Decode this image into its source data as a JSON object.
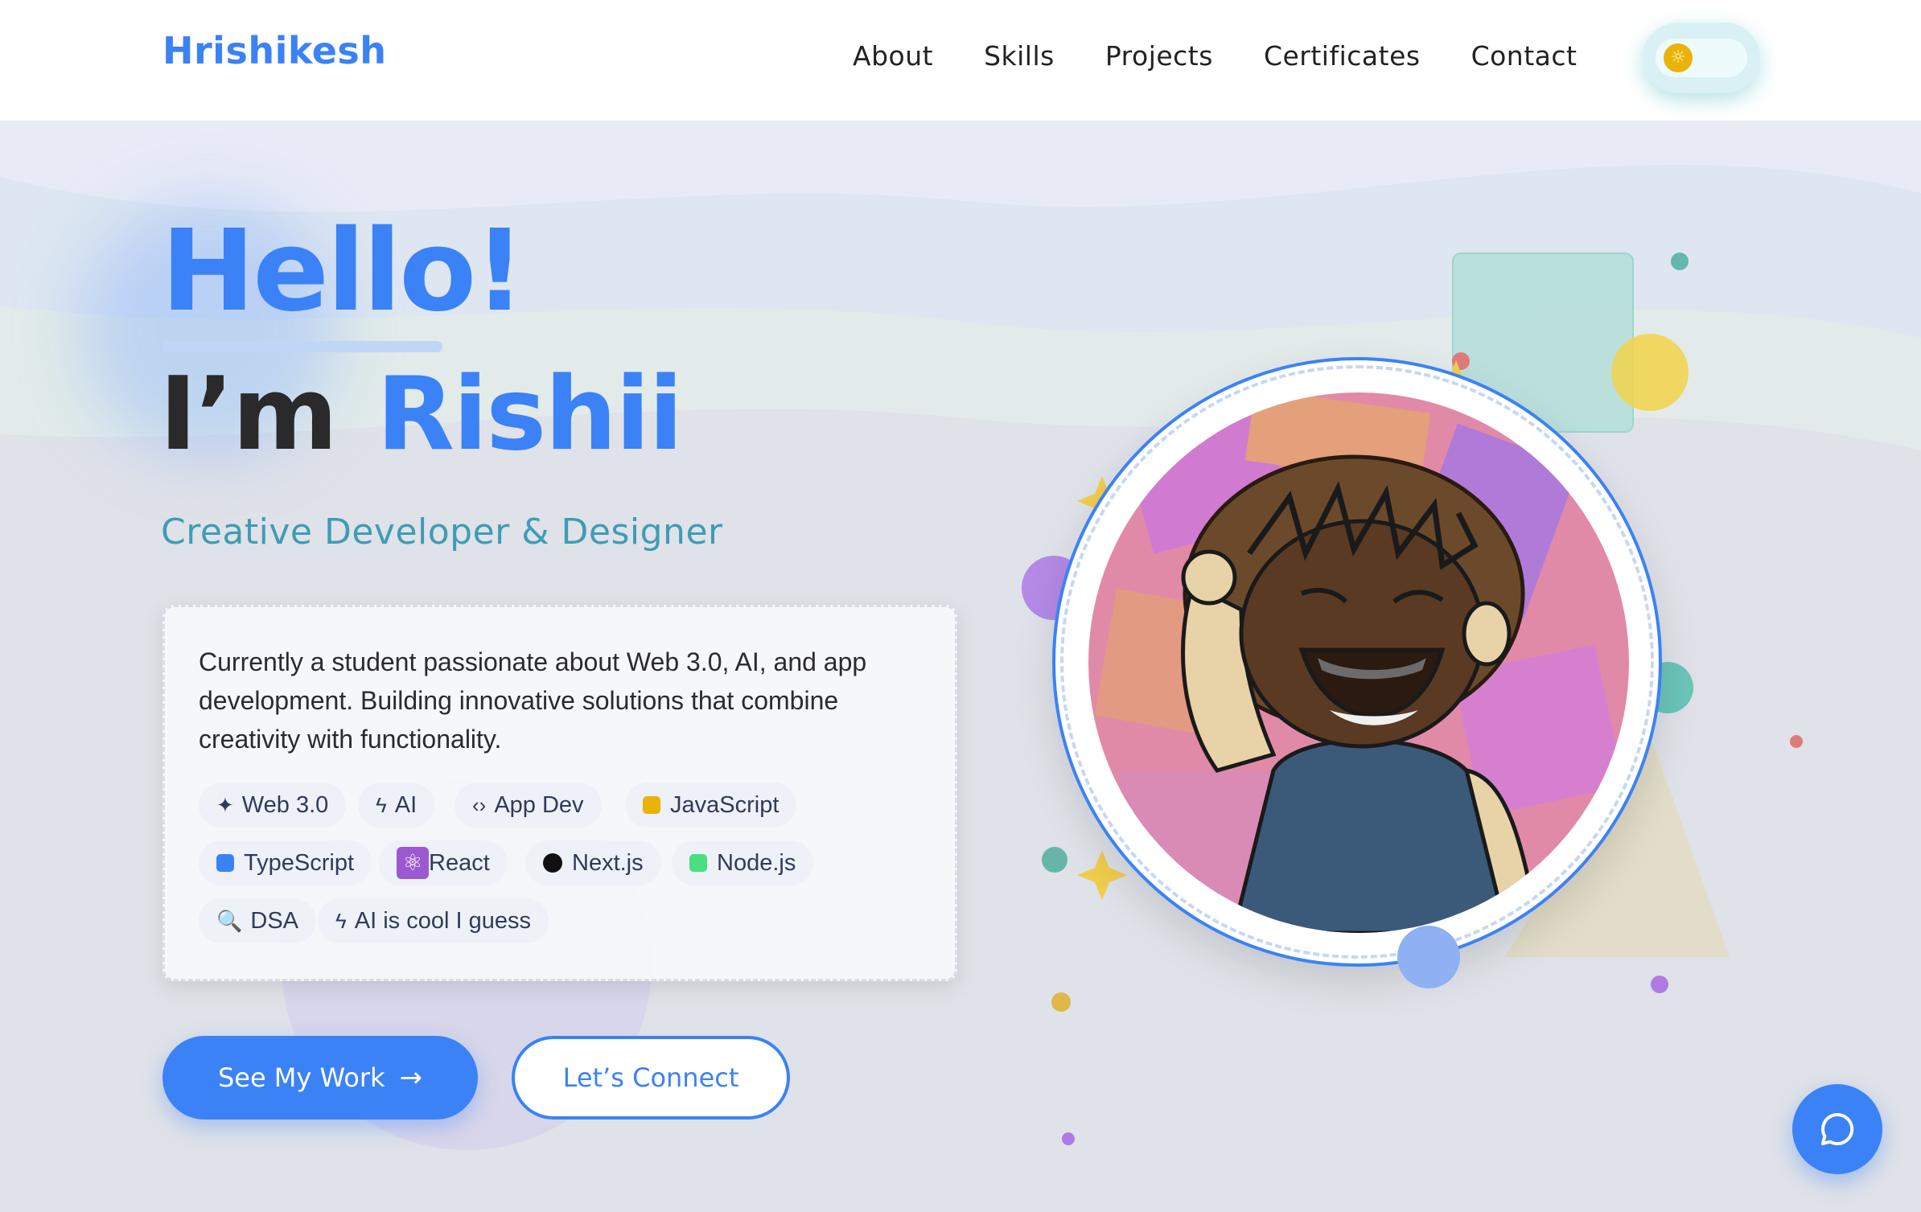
{
  "brand": "Hrishikesh",
  "nav": [
    {
      "label": "About"
    },
    {
      "label": "Skills"
    },
    {
      "label": "Projects"
    },
    {
      "label": "Certificates"
    },
    {
      "label": "Contact"
    }
  ],
  "theme_toggle": {
    "icon": "sun-icon"
  },
  "hero": {
    "hello": "Hello!",
    "im": "I’m",
    "name": "Rishii",
    "tagline": "Creative Developer & Designer"
  },
  "about": {
    "text": "Currently a student passionate about Web 3.0, AI, and app development. Building innovative solutions that combine creativity with functionality.",
    "chips": [
      {
        "label": "Web 3.0",
        "icon": "sparkles-icon"
      },
      {
        "label": "AI",
        "icon": "lightning-icon"
      },
      {
        "label": "App Dev",
        "icon": "code-icon"
      },
      {
        "label": "JavaScript",
        "icon": "javascript-icon",
        "color": "#eab308"
      },
      {
        "label": "TypeScript",
        "icon": "typescript-icon",
        "color": "#3b82f6"
      },
      {
        "label": "React",
        "icon": "atom-icon",
        "color": "#9b59d0"
      },
      {
        "label": "Next.js",
        "icon": "nextjs-icon",
        "color": "#111111"
      },
      {
        "label": "Node.js",
        "icon": "nodejs-icon",
        "color": "#4ade80"
      },
      {
        "label": "DSA",
        "icon": "magnifier-icon"
      },
      {
        "label": "AI is cool I guess",
        "icon": "lightning-icon"
      }
    ]
  },
  "buttons": {
    "primary": "See My Work",
    "secondary": "Let’s Connect"
  },
  "colors": {
    "accent": "#3b82f6",
    "teal": "#3f9cb4",
    "yellow": "#eab308",
    "purple": "#a77be8"
  },
  "chat": {
    "icon": "chat-bubble-icon"
  }
}
